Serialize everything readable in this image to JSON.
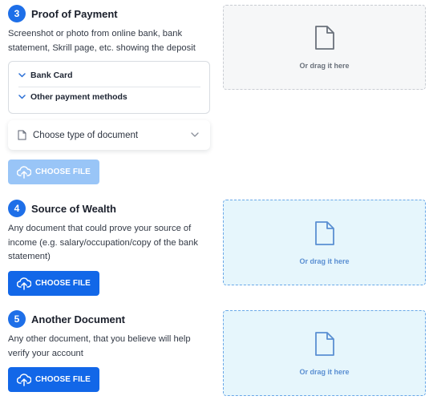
{
  "sections": {
    "proof": {
      "number": "3",
      "title": "Proof of Payment",
      "description": "Screenshot or photo from online bank, bank statement, Skrill page, etc. showing the deposit",
      "methods": [
        "Bank Card",
        "Other payment methods"
      ],
      "select_placeholder": "Choose type of document",
      "button_label": "CHOOSE FILE",
      "drop_label": "Or drag it here",
      "button_state": "disabled"
    },
    "wealth": {
      "number": "4",
      "title": "Source of Wealth",
      "description": "Any document that could prove your source of income (e.g. salary/occupation/copy of the bank statement)",
      "button_label": "CHOOSE FILE",
      "drop_label": "Or drag it here"
    },
    "another": {
      "number": "5",
      "title": "Another Document",
      "description": "Any other document, that you believe will help verify your account",
      "button_label": "CHOOSE FILE",
      "drop_label": "Or drag it here"
    }
  },
  "colors": {
    "accent": "#1267e8",
    "accent_disabled": "#99c5f7",
    "drop_blue_bg": "#e6f6fc",
    "drop_grey_bg": "#f6f7f8"
  },
  "icons": {
    "upload": "cloud-upload-icon",
    "file": "file-icon",
    "chevron": "chevron-down-icon",
    "document": "document-icon"
  }
}
